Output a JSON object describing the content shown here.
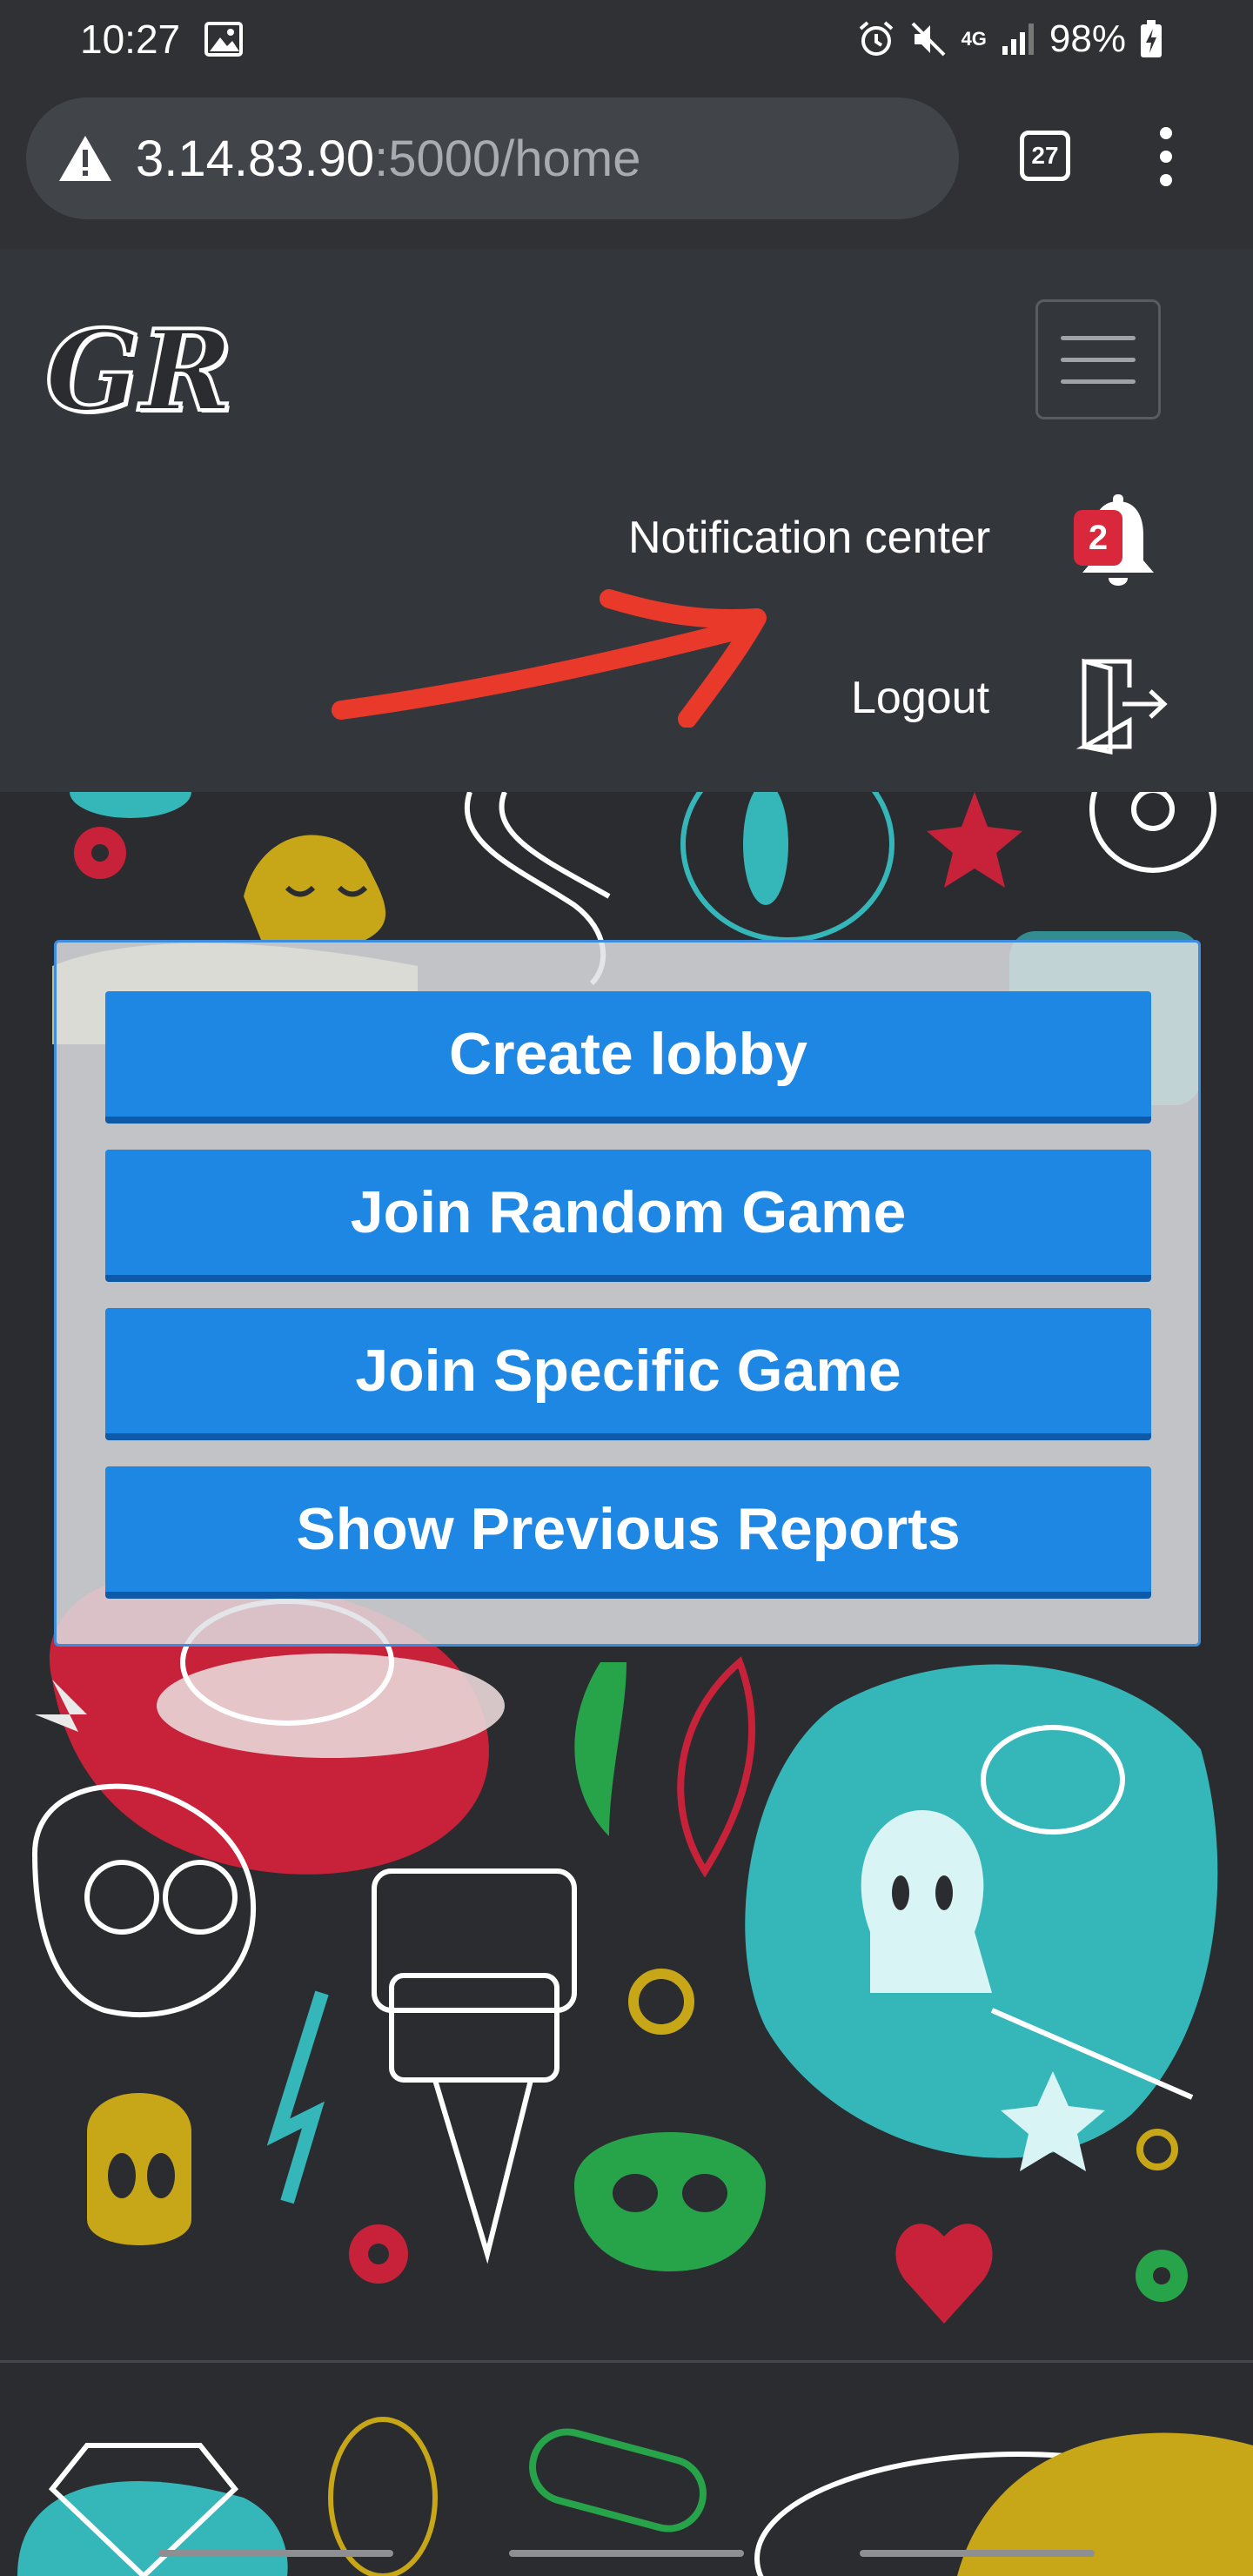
{
  "status_bar": {
    "time": "10:27",
    "network": "4G",
    "battery": "98%",
    "icons": [
      "image-icon",
      "alarm-icon",
      "mute-icon",
      "signal-icon",
      "battery-charging-icon"
    ]
  },
  "browser": {
    "warning_icon": "warning-icon",
    "url_host": "3.14.83.90",
    "url_path": ":5000/home",
    "tab_count": "27",
    "menu_icon": "more-vertical-icon"
  },
  "navbar": {
    "logo_text": "GR",
    "notification_label": "Notification center",
    "notification_count": "2",
    "logout_label": "Logout",
    "icons": [
      "bell-icon",
      "logout-icon",
      "hamburger-icon"
    ]
  },
  "menu": {
    "buttons": [
      {
        "label": "Create lobby"
      },
      {
        "label": "Join Random Game"
      },
      {
        "label": "Join Specific Game"
      },
      {
        "label": "Show Previous Reports"
      }
    ]
  },
  "colors": {
    "button_blue": "#1e86e3",
    "navbar_bg": "#33363b",
    "badge_red": "#d9273b",
    "annotation_red": "#e8392b"
  }
}
